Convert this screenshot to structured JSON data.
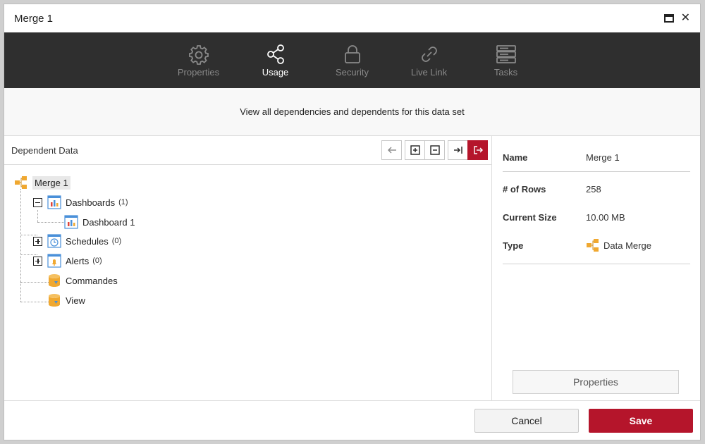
{
  "window": {
    "title": "Merge 1"
  },
  "tabs": [
    {
      "label": "Properties",
      "icon": "gear-icon",
      "active": false
    },
    {
      "label": "Usage",
      "icon": "share-icon",
      "active": true
    },
    {
      "label": "Security",
      "icon": "lock-icon",
      "active": false
    },
    {
      "label": "Live Link",
      "icon": "link-icon",
      "active": false
    },
    {
      "label": "Tasks",
      "icon": "server-icon",
      "active": false
    }
  ],
  "subtitle": "View all dependencies and dependents for this data set",
  "left_pane": {
    "title": "Dependent Data",
    "tree": {
      "root": "Merge 1",
      "dashboards": {
        "label": "Dashboards",
        "count": "(1)"
      },
      "dashboard_1": "Dashboard 1",
      "schedules": {
        "label": "Schedules",
        "count": "(0)"
      },
      "alerts": {
        "label": "Alerts",
        "count": "(0)"
      },
      "commandes": "Commandes",
      "view": "View"
    }
  },
  "details": {
    "name_label": "Name",
    "name_value": "Merge 1",
    "rows_label": "# of Rows",
    "rows_value": "258",
    "size_label": "Current Size",
    "size_value": "10.00 MB",
    "type_label": "Type",
    "type_value": "Data Merge",
    "properties_button": "Properties"
  },
  "footer": {
    "cancel": "Cancel",
    "save": "Save"
  },
  "colors": {
    "accent": "#b5152b",
    "tabbar": "#2f2f2f"
  }
}
